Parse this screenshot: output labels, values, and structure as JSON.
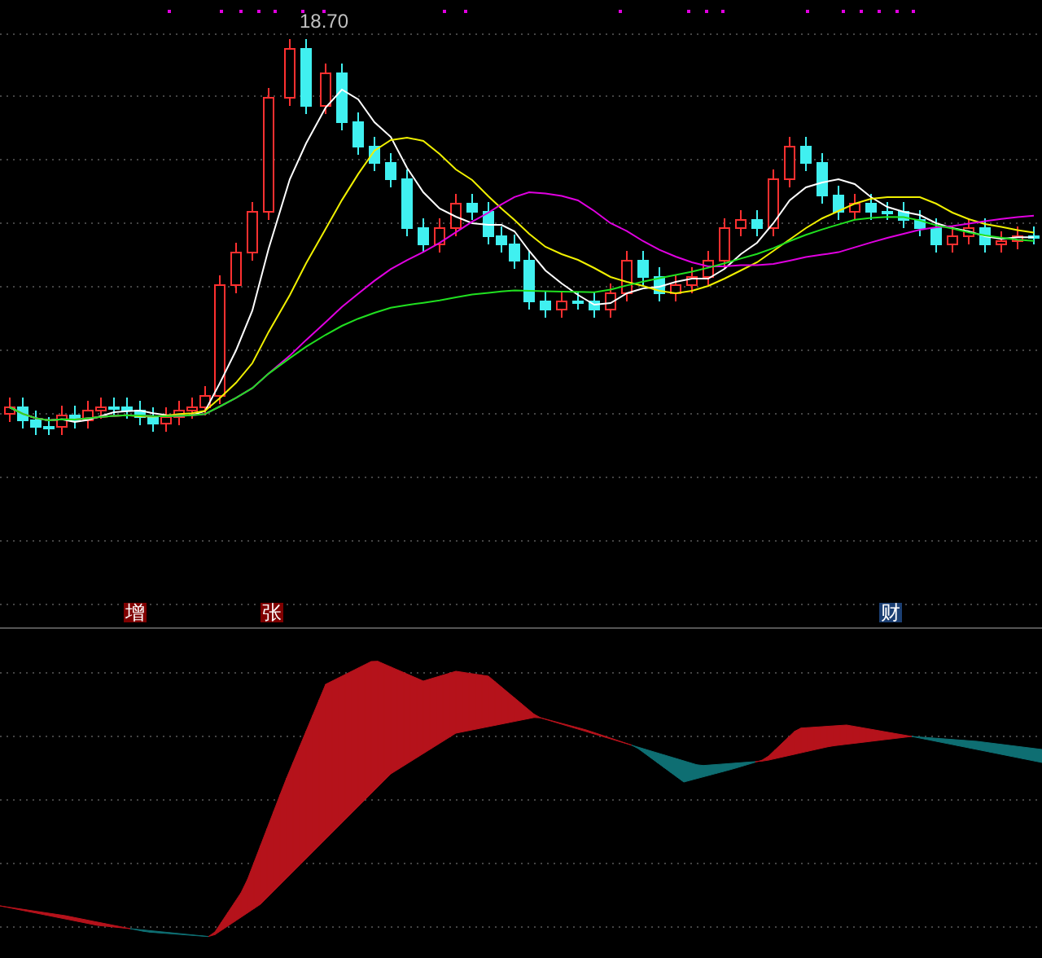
{
  "price_chart": {
    "peak_label": "18.70"
  },
  "signals": [
    {
      "text": "增",
      "color": "#800000"
    },
    {
      "text": "张",
      "color": "#800000"
    },
    {
      "text": "财",
      "color": "#1b3f73"
    }
  ]
}
